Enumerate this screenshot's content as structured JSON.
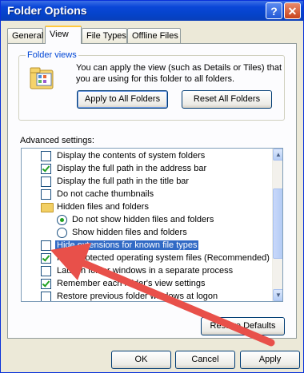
{
  "window": {
    "title": "Folder Options"
  },
  "titlebar": {
    "help_glyph": "?",
    "close_glyph": "✕"
  },
  "tabs": [
    {
      "label": "General"
    },
    {
      "label": "View"
    },
    {
      "label": "File Types"
    },
    {
      "label": "Offline Files"
    }
  ],
  "folder_views": {
    "legend": "Folder views",
    "description": "You can apply the view (such as Details or Tiles) that you are using for this folder to all folders.",
    "apply_all_label": "Apply to All Folders",
    "reset_all_label": "Reset All Folders"
  },
  "advanced": {
    "label": "Advanced settings:",
    "items": [
      {
        "label": "Display the contents of system folders",
        "type": "checkbox",
        "checked": false
      },
      {
        "label": "Display the full path in the address bar",
        "type": "checkbox",
        "checked": true
      },
      {
        "label": "Display the full path in the title bar",
        "type": "checkbox",
        "checked": false
      },
      {
        "label": "Do not cache thumbnails",
        "type": "checkbox",
        "checked": false
      },
      {
        "label": "Hidden files and folders",
        "type": "folder"
      },
      {
        "label": "Do not show hidden files and folders",
        "type": "radio",
        "checked": true
      },
      {
        "label": "Show hidden files and folders",
        "type": "radio",
        "checked": false
      },
      {
        "label": "Hide extensions for known file types",
        "type": "checkbox",
        "checked": false,
        "selected": true
      },
      {
        "label": "Hide protected operating system files (Recommended)",
        "type": "checkbox",
        "checked": true
      },
      {
        "label": "Launch folder windows in a separate process",
        "type": "checkbox",
        "checked": false
      },
      {
        "label": "Remember each folder's view settings",
        "type": "checkbox",
        "checked": true
      },
      {
        "label": "Restore previous folder windows at logon",
        "type": "checkbox",
        "checked": false
      }
    ]
  },
  "buttons": {
    "restore_defaults": "Restore Defaults",
    "ok": "OK",
    "cancel": "Cancel",
    "apply": "Apply"
  },
  "colors": {
    "title_bar": "#0a47d8",
    "selection": "#316ac5",
    "annotation_arrow": "#e8504a"
  }
}
